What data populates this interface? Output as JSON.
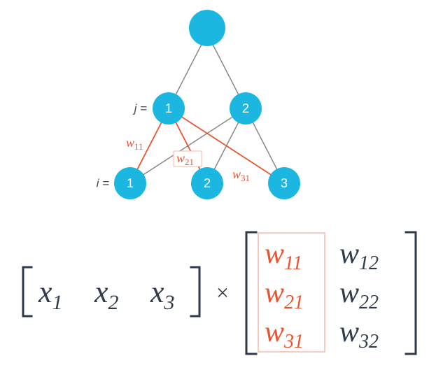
{
  "network": {
    "j_label": "j =",
    "i_label": "i =",
    "top_node": "",
    "hidden": [
      "1",
      "2"
    ],
    "input": [
      "1",
      "2",
      "3"
    ],
    "edge_labels": {
      "w11": "w",
      "w11_sub": "11",
      "w21": "w",
      "w21_sub": "21",
      "w31": "w",
      "w31_sub": "31"
    }
  },
  "equation": {
    "x": [
      "x",
      "x",
      "x"
    ],
    "x_sub": [
      "1",
      "2",
      "3"
    ],
    "times": "×",
    "W": [
      [
        {
          "base": "w",
          "sub": "11",
          "hl": true
        },
        {
          "base": "w",
          "sub": "12",
          "hl": false
        }
      ],
      [
        {
          "base": "w",
          "sub": "21",
          "hl": true
        },
        {
          "base": "w",
          "sub": "22",
          "hl": false
        }
      ],
      [
        {
          "base": "w",
          "sub": "31",
          "hl": true
        },
        {
          "base": "w",
          "sub": "32",
          "hl": false
        }
      ]
    ]
  }
}
